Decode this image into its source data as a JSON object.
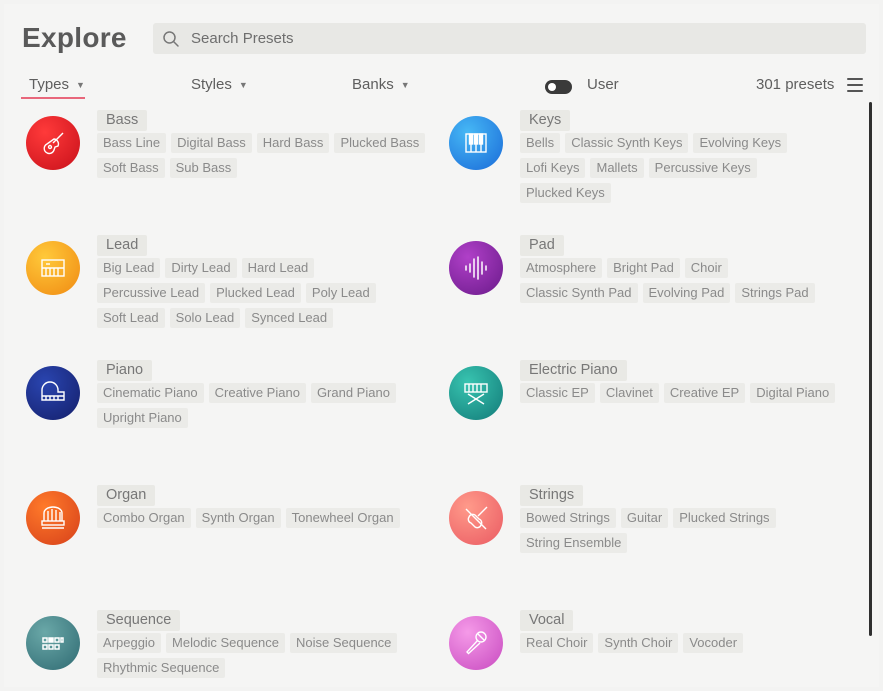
{
  "header": {
    "title": "Explore",
    "search_placeholder": "Search Presets"
  },
  "filters": {
    "types": "Types",
    "styles": "Styles",
    "banks": "Banks",
    "user_label": "User",
    "user_toggle_on": false,
    "preset_count": "301 presets"
  },
  "colors": {
    "accent_underline": "#e8677b",
    "bass": "#e01e24",
    "keys": "#2a8fe0",
    "lead": "#f0a21c",
    "pad": "#8a2aa0",
    "piano": "#1e2f8e",
    "electric_piano": "#1fa197",
    "organ": "#e8541e",
    "strings": "#f07070",
    "sequence": "#4a8a8a",
    "vocal": "#e070d0"
  },
  "categories": [
    {
      "name": "Bass",
      "icon": "guitar-icon",
      "tags": [
        "Bass Line",
        "Digital Bass",
        "Hard Bass",
        "Plucked Bass",
        "Soft Bass",
        "Sub Bass"
      ]
    },
    {
      "name": "Keys",
      "icon": "keys-icon",
      "tags": [
        "Bells",
        "Classic Synth Keys",
        "Evolving Keys",
        "Lofi Keys",
        "Mallets",
        "Percussive Keys",
        "Plucked Keys"
      ]
    },
    {
      "name": "Lead",
      "icon": "synth-keyboard-icon",
      "tags": [
        "Big Lead",
        "Dirty Lead",
        "Hard Lead",
        "Percussive Lead",
        "Plucked Lead",
        "Poly Lead",
        "Soft Lead",
        "Solo Lead",
        "Synced Lead"
      ]
    },
    {
      "name": "Pad",
      "icon": "waveform-icon",
      "tags": [
        "Atmosphere",
        "Bright Pad",
        "Choir",
        "Classic Synth Pad",
        "Evolving Pad",
        "Strings Pad"
      ]
    },
    {
      "name": "Piano",
      "icon": "grand-piano-icon",
      "tags": [
        "Cinematic Piano",
        "Creative Piano",
        "Grand Piano",
        "Upright Piano"
      ]
    },
    {
      "name": "Electric Piano",
      "icon": "keyboard-stand-icon",
      "tags": [
        "Classic EP",
        "Clavinet",
        "Creative EP",
        "Digital Piano"
      ]
    },
    {
      "name": "Organ",
      "icon": "organ-icon",
      "tags": [
        "Combo Organ",
        "Synth Organ",
        "Tonewheel Organ"
      ]
    },
    {
      "name": "Strings",
      "icon": "violin-icon",
      "tags": [
        "Bowed Strings",
        "Guitar",
        "Plucked Strings",
        "String Ensemble"
      ]
    },
    {
      "name": "Sequence",
      "icon": "sequencer-icon",
      "tags": [
        "Arpeggio",
        "Melodic Sequence",
        "Noise Sequence",
        "Rhythmic Sequence"
      ]
    },
    {
      "name": "Vocal",
      "icon": "microphone-icon",
      "tags": [
        "Real Choir",
        "Synth Choir",
        "Vocoder"
      ]
    }
  ]
}
